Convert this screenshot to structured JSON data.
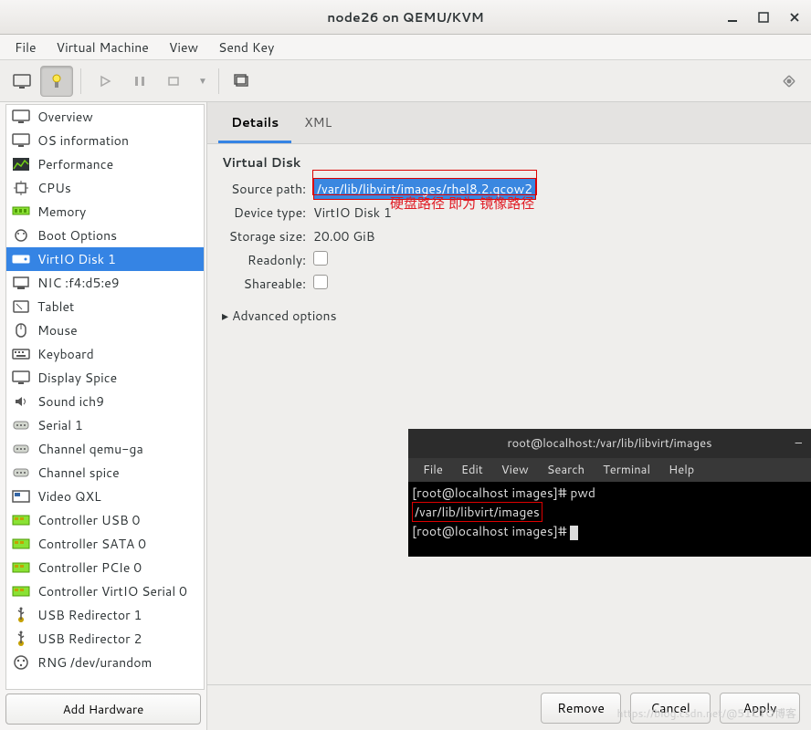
{
  "window": {
    "title": "node26 on QEMU/KVM"
  },
  "menubar": [
    "File",
    "Virtual Machine",
    "View",
    "Send Key"
  ],
  "sidebar": {
    "items": [
      {
        "label": "Overview",
        "icon": "monitor-icon"
      },
      {
        "label": "OS information",
        "icon": "monitor-icon"
      },
      {
        "label": "Performance",
        "icon": "chart-icon"
      },
      {
        "label": "CPUs",
        "icon": "cpu-icon"
      },
      {
        "label": "Memory",
        "icon": "memory-icon"
      },
      {
        "label": "Boot Options",
        "icon": "boot-icon"
      },
      {
        "label": "VirtIO Disk 1",
        "icon": "disk-icon",
        "selected": true
      },
      {
        "label": "NIC :f4:d5:e9",
        "icon": "nic-icon"
      },
      {
        "label": "Tablet",
        "icon": "tablet-icon"
      },
      {
        "label": "Mouse",
        "icon": "mouse-icon"
      },
      {
        "label": "Keyboard",
        "icon": "keyboard-icon"
      },
      {
        "label": "Display Spice",
        "icon": "display-icon"
      },
      {
        "label": "Sound ich9",
        "icon": "sound-icon"
      },
      {
        "label": "Serial 1",
        "icon": "serial-icon"
      },
      {
        "label": "Channel qemu-ga",
        "icon": "channel-icon"
      },
      {
        "label": "Channel spice",
        "icon": "channel-icon"
      },
      {
        "label": "Video QXL",
        "icon": "video-icon"
      },
      {
        "label": "Controller USB 0",
        "icon": "controller-icon"
      },
      {
        "label": "Controller SATA 0",
        "icon": "controller-icon"
      },
      {
        "label": "Controller PCIe 0",
        "icon": "controller-icon"
      },
      {
        "label": "Controller VirtIO Serial 0",
        "icon": "controller-icon"
      },
      {
        "label": "USB Redirector 1",
        "icon": "usb-icon"
      },
      {
        "label": "USB Redirector 2",
        "icon": "usb-icon"
      },
      {
        "label": "RNG /dev/urandom",
        "icon": "rng-icon"
      }
    ],
    "add_hw": "Add Hardware"
  },
  "details": {
    "tabs": [
      "Details",
      "XML"
    ],
    "active_tab": 0,
    "section_title": "Virtual Disk",
    "fields": {
      "source_path_lbl": "Source path:",
      "source_path_val": "/var/lib/libvirt/images/rhel8.2.qcow2",
      "device_type_lbl": "Device type:",
      "device_type_val": "VirtIO Disk 1",
      "storage_size_lbl": "Storage size:",
      "storage_size_val": "20.00 GiB",
      "readonly_lbl": "Readonly:",
      "shareable_lbl": "Shareable:"
    },
    "advanced": "Advanced options",
    "callout": "硬盘路径  即为  镜像路径"
  },
  "terminal": {
    "title": "root@localhost:/var/lib/libvirt/images",
    "menu": [
      "File",
      "Edit",
      "View",
      "Search",
      "Terminal",
      "Help"
    ],
    "line1_prompt": "[root@localhost images]# ",
    "line1_cmd": "pwd",
    "line2": "/var/lib/libvirt/images",
    "line3_prompt": "[root@localhost images]# "
  },
  "buttons": {
    "remove": "Remove",
    "cancel": "Cancel",
    "apply": "Apply"
  },
  "watermark": "https://blog.csdn.net/@51CTO博客"
}
